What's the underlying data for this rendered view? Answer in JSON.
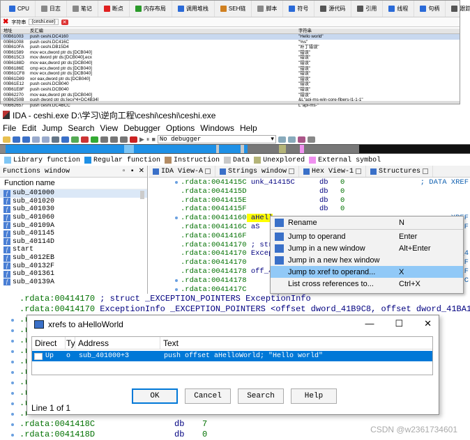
{
  "top_panel": {
    "tabs": [
      {
        "icon": "cpu-icon",
        "label": "CPU",
        "color": "#2a6ad8"
      },
      {
        "icon": "log-icon",
        "label": "日志",
        "color": "#888888"
      },
      {
        "icon": "notes-icon",
        "label": "笔记",
        "color": "#888888"
      },
      {
        "icon": "breakpoint-icon",
        "label": "断点",
        "color": "#e02020"
      },
      {
        "icon": "memory-map-icon",
        "label": "内存布局",
        "color": "#2a9a2a"
      },
      {
        "icon": "call-stack-icon",
        "label": "调用堆栈",
        "color": "#2a6ad8"
      },
      {
        "icon": "seh-icon",
        "label": "SEH链",
        "color": "#d08020"
      },
      {
        "icon": "script-icon",
        "label": "脚本",
        "color": "#888888"
      },
      {
        "icon": "symbols-icon",
        "label": "符号",
        "color": "#2a6ad8"
      },
      {
        "icon": "source-icon",
        "label": "源代码",
        "color": "#555555"
      },
      {
        "icon": "references-icon",
        "label": "引用",
        "color": "#555555"
      },
      {
        "icon": "threads-icon",
        "label": "线程",
        "color": "#2a6ad8"
      },
      {
        "icon": "handles-icon",
        "label": "句柄",
        "color": "#2a6ad8"
      },
      {
        "icon": "trace-icon",
        "label": "跟踪",
        "color": "#555555"
      }
    ],
    "subtab_prefix": "字符串",
    "subtab_label": "(ceshi.exe)",
    "columns": [
      "地址",
      "反汇编",
      "字符串"
    ],
    "rows": [
      {
        "addr": "00B61003",
        "asm": "push ceshi.DC4160",
        "str": "\"Hello world\"",
        "selected": true
      },
      {
        "addr": "00B61008",
        "asm": "push ceshi.DC416C",
        "str": "\"%s\""
      },
      {
        "addr": "00B610FA",
        "asm": "push ceshi.DB15D4",
        "str": "\"补丁错误\""
      },
      {
        "addr": "00B61589",
        "asm": "mov ecx,dword ptr ds:[DCB040]",
        "str": "\"错误\""
      },
      {
        "addr": "00B615C3",
        "asm": "mov dword ptr ds:[DCB040],ecx",
        "str": "\"错误\""
      },
      {
        "addr": "00B6188D",
        "asm": "mov eax,dword ptr ds:[DCB040]",
        "str": "\"错误\""
      },
      {
        "addr": "00B6186E",
        "asm": "cmp ecx,dword ptr ds:[DCB040]",
        "str": "\"错误\""
      },
      {
        "addr": "00B61CF8",
        "asm": "mov ecx,dword ptr ds:[DCB040]",
        "str": "\"错误\""
      },
      {
        "addr": "00B61D89",
        "asm": "xor eax,dword ptr ds:[DCB040]",
        "str": "\"错误\""
      },
      {
        "addr": "00B61E12",
        "asm": "push ceshi.DCB040",
        "str": "\"错误\""
      },
      {
        "addr": "00B61E8F",
        "asm": "push ceshi.DCB040",
        "str": "\"错误\""
      },
      {
        "addr": "00B62270",
        "asm": "mov eax,dword ptr ds:[DCB040]",
        "str": "\"错误\""
      },
      {
        "addr": "00B6250B",
        "asm": "push dword ptr ds:[ecx*4+DC4B34]",
        "str": "&L\"api-ms-win-core-fibers-l1-1-1\""
      },
      {
        "addr": "00B62657",
        "asm": "push ceshi.DC4BCC",
        "str": "L\"api-ms-\""
      }
    ]
  },
  "ida": {
    "title": "IDA - ceshi.exe D:\\学习\\逆向工程\\ceshi\\ceshi\\ceshi.exe",
    "menu": [
      "File",
      "Edit",
      "Jump",
      "Search",
      "View",
      "Debugger",
      "Options",
      "Windows",
      "Help"
    ],
    "debugger_select": "No debugger",
    "legend": [
      {
        "label": "Library function",
        "color": "#7ec6f5"
      },
      {
        "label": "Regular function",
        "color": "#1e90e6"
      },
      {
        "label": "Instruction",
        "color": "#b48c64"
      },
      {
        "label": "Data",
        "color": "#c8c8c8"
      },
      {
        "label": "Unexplored",
        "color": "#b4b478"
      },
      {
        "label": "External symbol",
        "color": "#f090f0"
      }
    ],
    "functions_window": {
      "title": "Functions window",
      "column": "Function name",
      "items": [
        "sub_401000",
        "sub_401020",
        "sub_401030",
        "sub_401060",
        "sub_40109A",
        "sub_401145",
        "sub_40114D",
        "start",
        "sub_4012EB",
        "sub_40132F",
        "sub_401361",
        "sub_40139A"
      ]
    },
    "view_tabs": [
      "IDA View-A",
      "Strings window",
      "Hex View-1",
      "Structures"
    ],
    "code_lines": [
      {
        "addr": ".rdata:0041415C",
        "rest": " unk_41415C",
        "op": "db",
        "val": "0",
        "cmt": "; DATA XREF",
        "dot": true
      },
      {
        "addr": ".rdata:0041415D",
        "rest": "",
        "op": "db",
        "val": "0",
        "cmt": ""
      },
      {
        "addr": ".rdata:0041415E",
        "rest": "",
        "op": "db",
        "val": "0",
        "cmt": ""
      },
      {
        "addr": ".rdata:0041415F",
        "rest": "",
        "op": "db",
        "val": "0",
        "cmt": ""
      },
      {
        "addr": ".rdata:00414160",
        "rest": " aHell",
        "op": "",
        "val": "",
        "cmt": "XREF",
        "dot": true,
        "hl": true
      },
      {
        "addr": ".rdata:0041416C",
        "rest": " aS",
        "op": "",
        "val": "",
        "cmt": "XREF"
      },
      {
        "addr": ".rdata:0041416F",
        "rest": "",
        "op": "",
        "val": "",
        "cmt": ""
      },
      {
        "addr": ".rdata:00414170",
        "rest": " ; str",
        "op": "",
        "val": "",
        "cmt": ""
      },
      {
        "addr": ".rdata:00414170",
        "rest": " Excep",
        "op": "",
        "val": "",
        "cmt": "ord_4"
      },
      {
        "addr": ".rdata:00414170",
        "rest": "",
        "op": "",
        "val": "",
        "cmt": "XREF"
      },
      {
        "addr": ".rdata:00414178",
        "rest": " off_4",
        "op": "",
        "val": "",
        "cmt": "XREF"
      },
      {
        "addr": ".rdata:00414178",
        "rest": "",
        "op": "",
        "val": "",
        "cmt": "412FC",
        "dot": true
      },
      {
        "addr": ".rdata:0041417C",
        "rest": "",
        "op": "",
        "val": "",
        "cmt": "",
        "dot": true
      }
    ],
    "context_menu": [
      {
        "icon": "rename-icon",
        "label": "Rename",
        "key": "N"
      },
      {
        "sep": true
      },
      {
        "icon": "arrow-jump-icon",
        "label": "Jump to operand",
        "key": "Enter"
      },
      {
        "icon": "new-window-icon",
        "label": "Jump in a new window",
        "key": "Alt+Enter"
      },
      {
        "icon": "hex-window-icon",
        "label": "Jump in a new hex window",
        "key": ""
      },
      {
        "icon": "",
        "label": "Jump to xref to operand...",
        "key": "X",
        "selected": true
      },
      {
        "icon": "",
        "label": "List cross references to...",
        "key": "Ctrl+X"
      }
    ],
    "lower_lines": [
      {
        "addr": ".rdata:00414170",
        "text": " ; struct _EXCEPTION_POINTERS ExceptionInfo"
      },
      {
        "addr": ".rdata:00414170",
        "text": " ExceptionInfo   _EXCEPTION_POINTERS <offset dword_41B9C8, offset dword_41BA18>"
      }
    ],
    "lower_stubs": [
      ".r",
      ".r",
      ".r",
      ".r",
      ".r",
      ".r",
      ".r",
      ".r",
      ".r",
      ".r"
    ],
    "bottom_lines": [
      {
        "addr": ".rdata:0041418C",
        "op": "db",
        "val": "7"
      },
      {
        "addr": ".rdata:0041418D",
        "op": "db",
        "val": "0"
      }
    ]
  },
  "xrefs": {
    "title": "xrefs to aHelloWorld",
    "columns": [
      "Direct",
      "Ty",
      "Address",
      "Text"
    ],
    "row": {
      "direct": "Up",
      "type": "o",
      "address": "sub_401000+3",
      "text": "push    offset aHelloWorld; \"Hello world\""
    },
    "buttons": [
      "OK",
      "Cancel",
      "Search",
      "Help"
    ],
    "status": "Line 1 of 1"
  },
  "watermark": "CSDN @w2361734601"
}
